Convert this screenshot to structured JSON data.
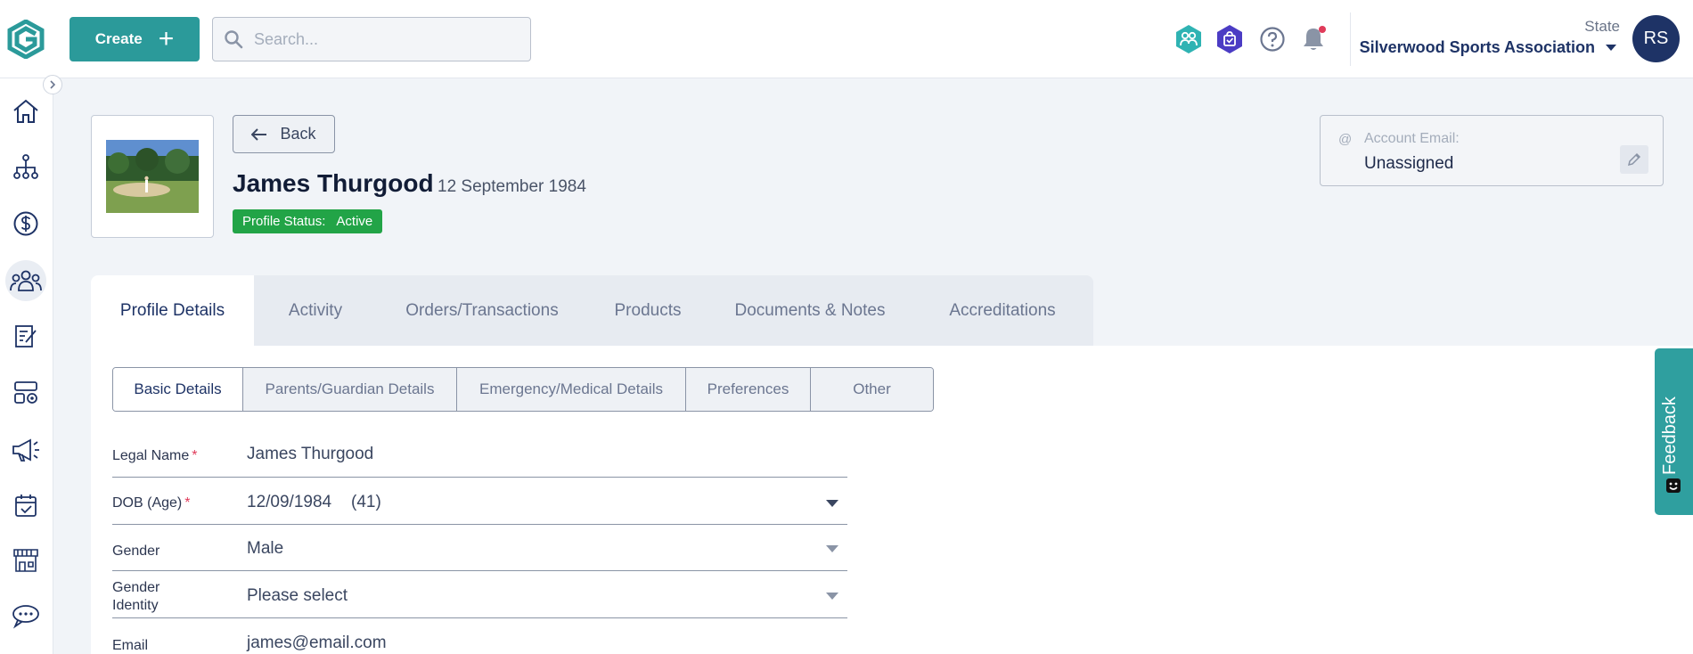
{
  "topbar": {
    "create_label": "Create",
    "search_placeholder": "Search...",
    "org_label": "State",
    "org_name": "Silverwood Sports Association",
    "avatar_initials": "RS"
  },
  "profile": {
    "back_label": "Back",
    "name": "James Thurgood",
    "dob_display": "12 September 1984",
    "status_label": "Profile Status:",
    "status_value": "Active",
    "account_email_label": "Account Email:",
    "account_email_value": "Unassigned"
  },
  "main_tabs": [
    "Profile Details",
    "Activity",
    "Orders/Transactions",
    "Products",
    "Documents & Notes",
    "Accreditations"
  ],
  "sub_tabs": [
    "Basic Details",
    "Parents/Guardian Details",
    "Emergency/Medical Details",
    "Preferences",
    "Other"
  ],
  "form": {
    "legal_name_label": "Legal Name",
    "legal_name_value": "James Thurgood",
    "dob_label": "DOB (Age)",
    "dob_value": "12/09/1984",
    "age_value": "(41)",
    "gender_label": "Gender",
    "gender_value": "Male",
    "gender_identity_label_1": "Gender",
    "gender_identity_label_2": "Identity",
    "gender_identity_value": "Please select",
    "email_label": "Email",
    "email_value": "james@email.com",
    "required_mark": "*"
  },
  "feedback_label": "Feedback",
  "colors": {
    "brand_teal": "#2b9a9a",
    "navy": "#1e3366",
    "status_green": "#22a447",
    "notification": "#e03b5a"
  }
}
